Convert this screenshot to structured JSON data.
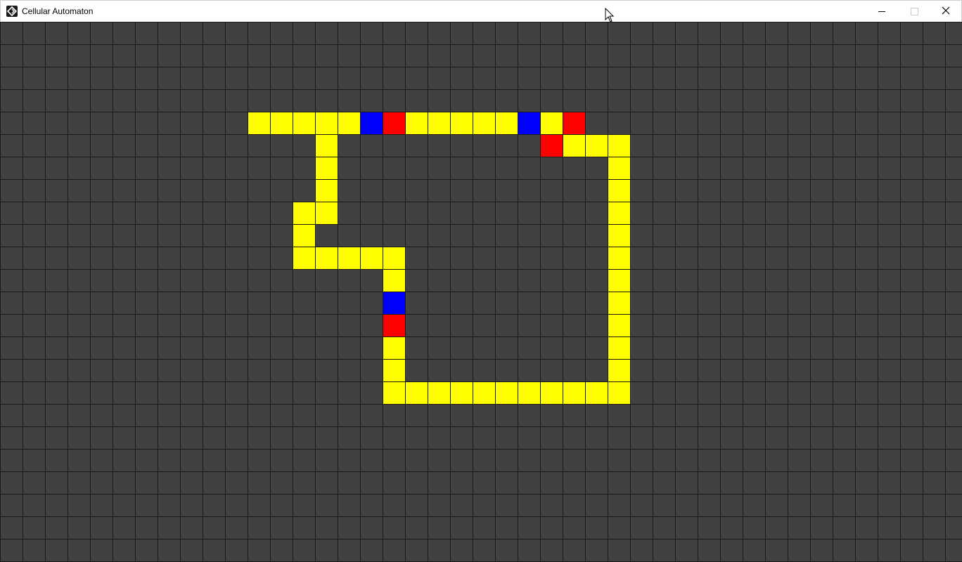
{
  "window": {
    "title": "Cellular Automaton",
    "controls": {
      "minimize": "minimize",
      "maximize": "maximize",
      "close": "close"
    }
  },
  "grid": {
    "columns": 43,
    "rows": 24,
    "colors": {
      "background": "#404040",
      "gridline": "#1a1a1a",
      "yellow": "#ffff00",
      "red": "#ff0000",
      "blue": "#0000ff"
    },
    "cells": [
      {
        "col": 11,
        "row": 4,
        "state": "yellow"
      },
      {
        "col": 12,
        "row": 4,
        "state": "yellow"
      },
      {
        "col": 13,
        "row": 4,
        "state": "yellow"
      },
      {
        "col": 14,
        "row": 4,
        "state": "yellow"
      },
      {
        "col": 15,
        "row": 4,
        "state": "yellow"
      },
      {
        "col": 16,
        "row": 4,
        "state": "blue"
      },
      {
        "col": 17,
        "row": 4,
        "state": "red"
      },
      {
        "col": 18,
        "row": 4,
        "state": "yellow"
      },
      {
        "col": 19,
        "row": 4,
        "state": "yellow"
      },
      {
        "col": 20,
        "row": 4,
        "state": "yellow"
      },
      {
        "col": 21,
        "row": 4,
        "state": "yellow"
      },
      {
        "col": 22,
        "row": 4,
        "state": "yellow"
      },
      {
        "col": 23,
        "row": 4,
        "state": "blue"
      },
      {
        "col": 24,
        "row": 4,
        "state": "yellow"
      },
      {
        "col": 25,
        "row": 4,
        "state": "red"
      },
      {
        "col": 14,
        "row": 5,
        "state": "yellow"
      },
      {
        "col": 24,
        "row": 5,
        "state": "red"
      },
      {
        "col": 25,
        "row": 5,
        "state": "yellow"
      },
      {
        "col": 26,
        "row": 5,
        "state": "yellow"
      },
      {
        "col": 27,
        "row": 5,
        "state": "yellow"
      },
      {
        "col": 14,
        "row": 6,
        "state": "yellow"
      },
      {
        "col": 27,
        "row": 6,
        "state": "yellow"
      },
      {
        "col": 14,
        "row": 7,
        "state": "yellow"
      },
      {
        "col": 27,
        "row": 7,
        "state": "yellow"
      },
      {
        "col": 13,
        "row": 8,
        "state": "yellow"
      },
      {
        "col": 14,
        "row": 8,
        "state": "yellow"
      },
      {
        "col": 27,
        "row": 8,
        "state": "yellow"
      },
      {
        "col": 13,
        "row": 9,
        "state": "yellow"
      },
      {
        "col": 27,
        "row": 9,
        "state": "yellow"
      },
      {
        "col": 13,
        "row": 10,
        "state": "yellow"
      },
      {
        "col": 14,
        "row": 10,
        "state": "yellow"
      },
      {
        "col": 15,
        "row": 10,
        "state": "yellow"
      },
      {
        "col": 16,
        "row": 10,
        "state": "yellow"
      },
      {
        "col": 17,
        "row": 10,
        "state": "yellow"
      },
      {
        "col": 27,
        "row": 10,
        "state": "yellow"
      },
      {
        "col": 17,
        "row": 11,
        "state": "yellow"
      },
      {
        "col": 27,
        "row": 11,
        "state": "yellow"
      },
      {
        "col": 17,
        "row": 12,
        "state": "blue"
      },
      {
        "col": 27,
        "row": 12,
        "state": "yellow"
      },
      {
        "col": 17,
        "row": 13,
        "state": "red"
      },
      {
        "col": 27,
        "row": 13,
        "state": "yellow"
      },
      {
        "col": 17,
        "row": 14,
        "state": "yellow"
      },
      {
        "col": 27,
        "row": 14,
        "state": "yellow"
      },
      {
        "col": 17,
        "row": 15,
        "state": "yellow"
      },
      {
        "col": 27,
        "row": 15,
        "state": "yellow"
      },
      {
        "col": 17,
        "row": 16,
        "state": "yellow"
      },
      {
        "col": 18,
        "row": 16,
        "state": "yellow"
      },
      {
        "col": 19,
        "row": 16,
        "state": "yellow"
      },
      {
        "col": 20,
        "row": 16,
        "state": "yellow"
      },
      {
        "col": 21,
        "row": 16,
        "state": "yellow"
      },
      {
        "col": 22,
        "row": 16,
        "state": "yellow"
      },
      {
        "col": 23,
        "row": 16,
        "state": "yellow"
      },
      {
        "col": 24,
        "row": 16,
        "state": "yellow"
      },
      {
        "col": 25,
        "row": 16,
        "state": "yellow"
      },
      {
        "col": 26,
        "row": 16,
        "state": "yellow"
      },
      {
        "col": 27,
        "row": 16,
        "state": "yellow"
      }
    ]
  }
}
